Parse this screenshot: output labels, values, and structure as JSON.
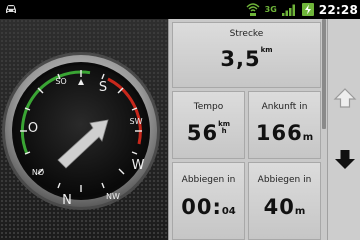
{
  "status_bar": {
    "network_type": "3G",
    "time": "22:28",
    "icons": [
      "car-icon",
      "gps-icon",
      "signal-icon",
      "battery-charging-icon"
    ]
  },
  "compass": {
    "directions": {
      "S": "S",
      "SO": "SO",
      "SW": "SW",
      "O": "O",
      "W": "W",
      "NO": "NO",
      "NW": "NW",
      "N": "N"
    },
    "heading_arrow_icon": "arrow-icon",
    "colors": {
      "arc_green": "#3aa534",
      "arc_red": "#c8281c",
      "face": "#0c0c0c",
      "bezel": "#b9b9b9"
    }
  },
  "info": {
    "strecke": {
      "label": "Strecke",
      "value": "3,5",
      "unit": "km"
    },
    "tempo": {
      "label": "Tempo",
      "value": "56",
      "unit_top": "km",
      "unit_bottom": "h"
    },
    "ankunft": {
      "label": "Ankunft in",
      "value": "166",
      "unit": "m"
    },
    "abbiegen1": {
      "label": "Abbiegen in",
      "value": "00:",
      "value_small": "04"
    },
    "abbiegen2": {
      "label": "Abbiegen in",
      "value": "40",
      "unit": "m"
    }
  },
  "scroll": {
    "up_icon": "arrow-up-icon",
    "down_icon": "arrow-down-icon"
  }
}
